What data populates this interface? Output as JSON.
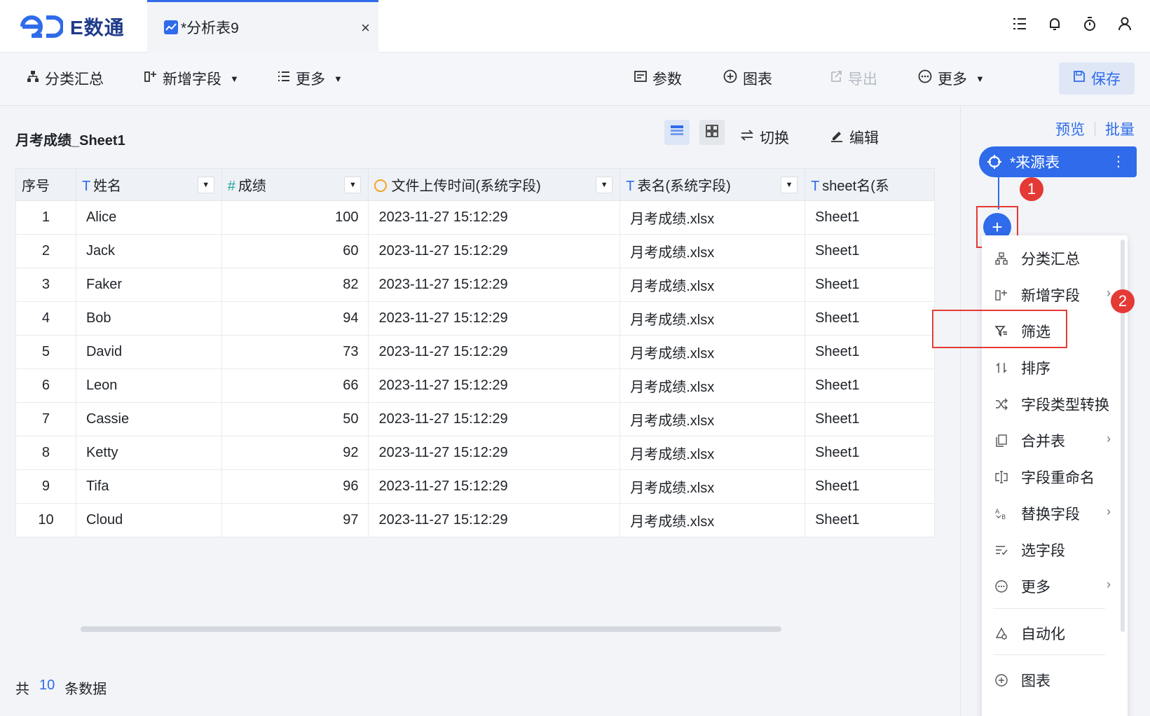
{
  "app": {
    "logo_text": "E数通"
  },
  "tab": {
    "label": "*分析表9",
    "close": "×"
  },
  "toolbar": {
    "group_summary": "分类汇总",
    "add_field": "新增字段",
    "more_left": "更多",
    "params": "参数",
    "chart": "图表",
    "export": "导出",
    "more_right": "更多",
    "save": "保存"
  },
  "main": {
    "title": "月考成绩_Sheet1",
    "switch_label": "切换",
    "edit_label": "编辑"
  },
  "table": {
    "columns": [
      "序号",
      "姓名",
      "成绩",
      "文件上传时间(系统字段)",
      "表名(系统字段)",
      "sheet名(系"
    ],
    "rows": [
      [
        "1",
        "Alice",
        "100",
        "2023-11-27 15:12:29",
        "月考成绩.xlsx",
        "Sheet1"
      ],
      [
        "2",
        "Jack",
        "60",
        "2023-11-27 15:12:29",
        "月考成绩.xlsx",
        "Sheet1"
      ],
      [
        "3",
        "Faker",
        "82",
        "2023-11-27 15:12:29",
        "月考成绩.xlsx",
        "Sheet1"
      ],
      [
        "4",
        "Bob",
        "94",
        "2023-11-27 15:12:29",
        "月考成绩.xlsx",
        "Sheet1"
      ],
      [
        "5",
        "David",
        "73",
        "2023-11-27 15:12:29",
        "月考成绩.xlsx",
        "Sheet1"
      ],
      [
        "6",
        "Leon",
        "66",
        "2023-11-27 15:12:29",
        "月考成绩.xlsx",
        "Sheet1"
      ],
      [
        "7",
        "Cassie",
        "50",
        "2023-11-27 15:12:29",
        "月考成绩.xlsx",
        "Sheet1"
      ],
      [
        "8",
        "Ketty",
        "92",
        "2023-11-27 15:12:29",
        "月考成绩.xlsx",
        "Sheet1"
      ],
      [
        "9",
        "Tifa",
        "96",
        "2023-11-27 15:12:29",
        "月考成绩.xlsx",
        "Sheet1"
      ],
      [
        "10",
        "Cloud",
        "97",
        "2023-11-27 15:12:29",
        "月考成绩.xlsx",
        "Sheet1"
      ]
    ]
  },
  "footer": {
    "prefix": "共",
    "count": "10",
    "suffix": "条数据"
  },
  "right_panel": {
    "preview": "预览",
    "batch": "批量",
    "source_node": "*来源表",
    "add": "+",
    "badge1": "1",
    "badge2": "2",
    "menu": [
      "分类汇总",
      "新增字段",
      "筛选",
      "排序",
      "字段类型转换",
      "合并表",
      "字段重命名",
      "替换字段",
      "选字段",
      "更多",
      "自动化",
      "图表"
    ]
  },
  "colors": {
    "accent": "#2f6bea",
    "highlight": "#e53935"
  }
}
